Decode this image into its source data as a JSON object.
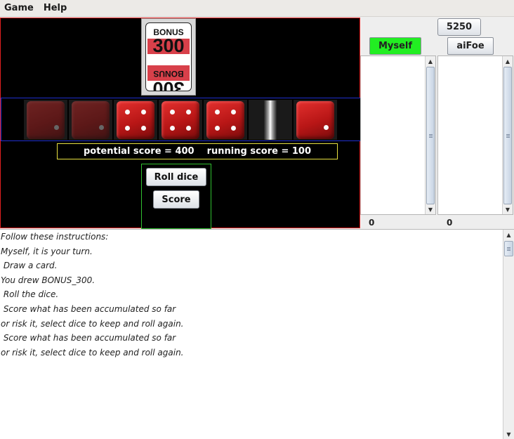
{
  "menu": {
    "items": [
      "Game",
      "Help"
    ]
  },
  "card": {
    "label": "BONUS",
    "value": "300",
    "band_color": "#d8404a"
  },
  "dice": [
    {
      "face": 1,
      "kept": true
    },
    {
      "face": 1,
      "kept": true
    },
    {
      "face": 4,
      "kept": false
    },
    {
      "face": 4,
      "kept": false
    },
    {
      "face": 4,
      "kept": false
    },
    {
      "face": null,
      "rolling": true
    },
    {
      "face": 1,
      "kept": false
    }
  ],
  "score": {
    "potential": "potential score = 400",
    "running": "running score = 100"
  },
  "buttons": {
    "roll": "Roll dice",
    "score": "Score"
  },
  "target_score": "5250",
  "players": [
    {
      "name": "Myself",
      "active": true,
      "score": "0",
      "highlight": "#22ee22"
    },
    {
      "name": "aiFoe",
      "active": false,
      "score": "0"
    }
  ],
  "log": [
    "Follow these instructions:",
    "Myself, it is your turn.",
    " Draw a card.",
    "You drew BONUS_300.",
    " Roll the dice.",
    " Score what has been accumulated so far",
    "or risk it, select dice to keep and roll again.",
    " Score what has been accumulated so far",
    "or risk it, select dice to keep and roll again."
  ]
}
